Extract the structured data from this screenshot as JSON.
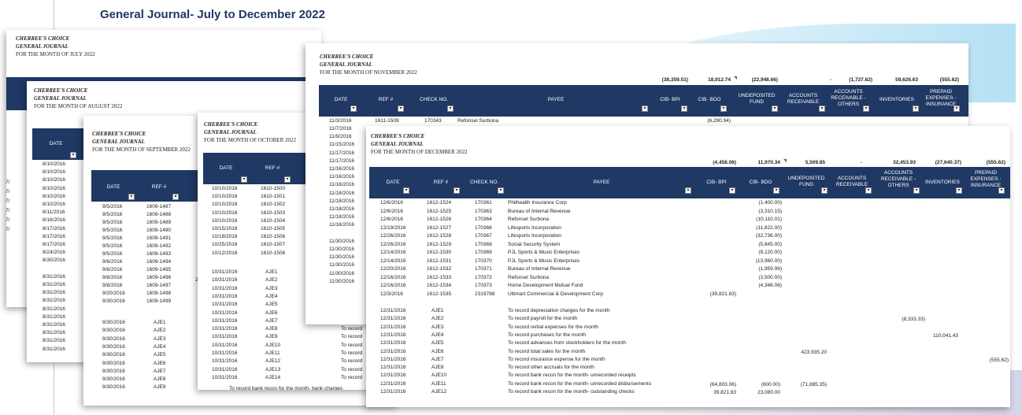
{
  "title": "General Journal- July to December 2022",
  "company": "CHERREE'S CHOICE",
  "journal": "GENERAL JOURNAL",
  "months": {
    "july": "FOR THE MONTH OF JULY 2022",
    "august": "FOR THE MONTH OF AUGUST 2022",
    "september": "FOR THE MONTH OF SEPTEMBER 2022",
    "october": "FOR THE MONTH OF OCTOBER 2022",
    "november": "FOR THE MONTH OF NOVEMBER 2022",
    "december": "FOR THE MONTH OF DECEMBER 2022"
  },
  "headers": {
    "date": "DATE",
    "ref": "REF #",
    "check": "CHECK NO.",
    "payee": "PAYEE",
    "bpi": "CIB- BPI",
    "bdo": "CIB- BDO",
    "undeposited": "UNDEPOSITED FUND",
    "ar": "ACCOUNTS RECEIVABLE",
    "ar_others": "ACCOUNTS RECEIVABLE - OTHERS",
    "inventories": "INVENTORIES",
    "prepaid": "PREPAID EXPENSES - INSURANCE"
  },
  "colors": {
    "header": "#1f3864",
    "title": "#1f3864"
  },
  "icons": {
    "filter": "filter-dropdown-icon"
  },
  "july_left": [
    "7/",
    "7/",
    "7/",
    "7/",
    "7/",
    "7/"
  ],
  "august_dates": [
    "8/10/2016",
    "8/10/2016",
    "8/10/2016",
    "8/10/2016",
    "8/10/2016",
    "8/10/2016",
    "8/11/2016",
    "8/16/2016",
    "8/17/2016",
    "8/17/2016",
    "8/17/2016",
    "8/24/2016",
    "8/30/2016",
    "",
    "8/31/2016",
    "8/31/2016",
    "8/31/2016",
    "8/31/2016",
    "8/31/2016",
    "8/31/2016",
    "8/31/2016",
    "8/31/2016",
    "8/31/2016",
    "8/31/2016"
  ],
  "september": {
    "rows": [
      [
        "9/5/2016",
        "1609-1487"
      ],
      [
        "9/5/2016",
        "1609-1488"
      ],
      [
        "9/5/2016",
        "1609-1489"
      ],
      [
        "9/5/2016",
        "1609-1490"
      ],
      [
        "9/5/2016",
        "1609-1491"
      ],
      [
        "9/5/2016",
        "1609-1492"
      ],
      [
        "9/5/2016",
        "1609-1493"
      ],
      [
        "9/6/2016",
        "1609-1494"
      ],
      [
        "9/6/2016",
        "1609-1495"
      ],
      [
        "9/8/2016",
        "1609-1496"
      ],
      [
        "9/8/2016",
        "1609-1497"
      ],
      [
        "9/20/2016",
        "1609-1498"
      ],
      [
        "9/30/2016",
        "1609-1499"
      ]
    ],
    "aje_rows": [
      [
        "9/30/2016",
        "AJE1"
      ],
      [
        "9/30/2016",
        "AJE2"
      ],
      [
        "9/30/2016",
        "AJE3"
      ],
      [
        "9/30/2016",
        "AJE4"
      ],
      [
        "9/30/2016",
        "AJE5"
      ],
      [
        "9/30/2016",
        "AJE6"
      ],
      [
        "9/30/2016",
        "AJE7"
      ],
      [
        "9/30/2016",
        "AJE8"
      ],
      [
        "9/30/2016",
        "AJE9"
      ]
    ],
    "side": "2"
  },
  "october": {
    "rows": [
      [
        "10/10/2016",
        "1610-1500"
      ],
      [
        "10/10/2016",
        "1610-1501"
      ],
      [
        "10/10/2016",
        "1610-1502"
      ],
      [
        "10/10/2016",
        "1610-1503"
      ],
      [
        "10/10/2016",
        "1610-1504"
      ],
      [
        "10/15/2016",
        "1610-1505"
      ],
      [
        "10/18/2016",
        "1610-1506"
      ],
      [
        "10/25/2016",
        "1610-1507"
      ],
      [
        "10/12/2016",
        "1610-1508"
      ]
    ],
    "aje_rows": [
      [
        "10/31/2016",
        "AJE1"
      ],
      [
        "10/31/2016",
        "AJE2"
      ],
      [
        "10/31/2016",
        "AJE3"
      ],
      [
        "10/31/2016",
        "AJE4"
      ],
      [
        "10/31/2016",
        "AJE5"
      ],
      [
        "10/31/2016",
        "AJE6"
      ],
      [
        "10/31/2016",
        "AJE7"
      ],
      [
        "10/31/2016",
        "AJE8"
      ],
      [
        "10/31/2016",
        "AJE9"
      ],
      [
        "10/31/2016",
        "AJE10"
      ],
      [
        "10/31/2016",
        "AJE11"
      ],
      [
        "10/31/2016",
        "AJE12"
      ],
      [
        "10/31/2016",
        "AJE13"
      ],
      [
        "10/31/2016",
        "AJE14"
      ]
    ],
    "to_record": [
      "To record",
      "To record",
      "To record",
      "To record",
      "To record",
      "To record",
      "To record"
    ],
    "footer": "To record bank recon for the month- bank charges"
  },
  "november": {
    "totals": [
      "(38,359.51)",
      "18,912.74",
      "(22,948.66)",
      "-",
      "(1,737.62)",
      "59,626.63",
      "(555.62)"
    ],
    "first_row": {
      "date": "11/3/2016",
      "ref": "1611-1509",
      "check": "170343",
      "payee": "Refonsel Surbona",
      "bdo": "(6,290.94)"
    },
    "dates": [
      "11/7/2016",
      "11/9/2016",
      "11/15/2016",
      "11/17/2016",
      "11/17/2016",
      "11/16/2016",
      "11/16/2016",
      "11/16/2016",
      "11/18/2016",
      "11/18/2016",
      "11/18/2016",
      "11/18/2016",
      "11/16/2016",
      "",
      "11/30/2016",
      "11/30/2016",
      "11/30/2016",
      "11/30/2016",
      "11/30/2016",
      "11/30/2016"
    ]
  },
  "december": {
    "totals": [
      "(4,458.06)",
      "11,970.34",
      "5,509.85",
      "-",
      "32,453.93",
      "(27,640.37)",
      "(555.62)"
    ],
    "rows": [
      [
        "12/6/2016",
        "1612-1524",
        "170361",
        "Philhealth Insurance Corp",
        "",
        "(1,400.00)"
      ],
      [
        "12/6/2016",
        "1612-1525",
        "170363",
        "Bureau of Internal Revenue",
        "",
        "(3,310.15)"
      ],
      [
        "12/6/2016",
        "1612-1526",
        "170364",
        "Refonsel Surbona",
        "",
        "(10,110.01)"
      ],
      [
        "12/19/2016",
        "1612-1527",
        "170366",
        "Lifesports Incorporation",
        "",
        "(11,822.00)"
      ],
      [
        "12/26/2016",
        "1612-1528",
        "170367",
        "Lifesports Incorporation",
        "",
        "(32,736.00)"
      ],
      [
        "12/26/2016",
        "1612-1529",
        "170368",
        "Social Security System",
        "",
        "(5,845.00)"
      ],
      [
        "12/14/2016",
        "1612-1530",
        "170369",
        "PJL Sports & Music Enterprises",
        "",
        "(9,120.00)"
      ],
      [
        "12/14/2016",
        "1612-1531",
        "170370",
        "PJL Sports & Music Enterprises",
        "",
        "(13,960.00)"
      ],
      [
        "12/20/2016",
        "1612-1532",
        "170371",
        "Bureau of Internal Revenue",
        "",
        "(1,959.99)"
      ],
      [
        "12/16/2016",
        "1612-1533",
        "170372",
        "Refonsel Surbona",
        "",
        "(3,500.00)"
      ],
      [
        "12/16/2016",
        "1612-1534",
        "170373",
        "Home Development Mutual Fund",
        "",
        "(4,346.06)"
      ],
      [
        "12/3/2016",
        "1612-1535",
        "2319788",
        "Ultimart Commercial & Development Corp",
        "(39,821.83)",
        ""
      ]
    ],
    "aje_rows": [
      [
        "12/31/2016",
        "AJE1",
        "To record depreciation charges for the month"
      ],
      [
        "12/31/2016",
        "AJE2",
        "To record payroll for the month"
      ],
      [
        "12/31/2016",
        "AJE3",
        "To record rental expenses for the month"
      ],
      [
        "12/31/2016",
        "AJE4",
        "To record purchases for the month"
      ],
      [
        "12/31/2016",
        "AJE5",
        "To record advances from stockholders for the month"
      ],
      [
        "12/31/2016",
        "AJE6",
        "To record total sales for the month"
      ],
      [
        "12/31/2016",
        "AJE7",
        "To record insurance expense for the month"
      ],
      [
        "12/31/2016",
        "AJE8",
        "To record other accruals for the month"
      ],
      [
        "12/31/2016",
        "AJE10",
        "To record bank recon for the month- unrecorded receipts"
      ],
      [
        "12/31/2016",
        "AJE11",
        "To record bank recon for the month- unrecorded disbursements"
      ],
      [
        "12/31/2016",
        "AJE12",
        "To record bank recon for the month- outstanding checks"
      ]
    ],
    "aje_values": {
      "r1_ar_others": "(8,333.33)",
      "r3_inventories": "110,041.43",
      "r5_undeposited": "423,935.20",
      "r6_prepaid": "(555.62)",
      "r9_bpi": "(64,803.06)",
      "r9_bdo": "(600.00)",
      "r9_undeposited": "(71,885.35)",
      "r10_bpi": "39,821.83",
      "r10_bdo": "23,080.00"
    }
  }
}
